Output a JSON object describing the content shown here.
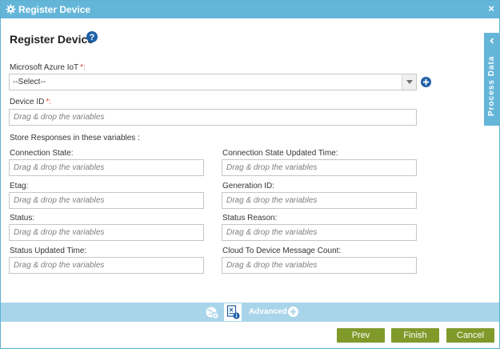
{
  "window": {
    "title": "Register Device",
    "close_label": "×"
  },
  "header": {
    "heading": "Register Device"
  },
  "azure": {
    "label": "Microsoft Azure IoT",
    "required_mark": "*:",
    "selected": "--Select--"
  },
  "device_id": {
    "label": "Device ID",
    "required_mark": "*:",
    "placeholder": "Drag & drop the variables"
  },
  "responses": {
    "section_label": "Store Responses in these variables :",
    "fields": [
      {
        "label": "Connection State:",
        "placeholder": "Drag & drop the variables"
      },
      {
        "label": "Connection State Updated Time:",
        "placeholder": "Drag & drop the variables"
      },
      {
        "label": "Etag:",
        "placeholder": "Drag & drop the variables"
      },
      {
        "label": "Generation ID:",
        "placeholder": "Drag & drop the variables"
      },
      {
        "label": "Status:",
        "placeholder": "Drag & drop the variables"
      },
      {
        "label": "Status Reason:",
        "placeholder": "Drag & drop the variables"
      },
      {
        "label": "Status Updated Time:",
        "placeholder": "Drag & drop the variables"
      },
      {
        "label": "Cloud To Device Message Count:",
        "placeholder": "Drag & drop the variables"
      }
    ]
  },
  "side_panel": {
    "label": "Process Data"
  },
  "toolbar": {
    "advanced_label": "Advanced"
  },
  "footer": {
    "prev_label": "Prev",
    "finish_label": "Finish",
    "cancel_label": "Cancel"
  },
  "colors": {
    "titlebar": "#64b6d9",
    "toolbar": "#a8d5ea",
    "button": "#7f9a2a",
    "required": "#e0433b",
    "icon_blue": "#1f5fa8"
  },
  "icons": {
    "title": "gear-icon",
    "help": "question-circle-icon",
    "add": "plus-circle-icon",
    "side_tab": "chevron-left-icon",
    "toolbar_1": "globe-gear-icon",
    "toolbar_2": "document-info-icon",
    "advanced": "plus-circle-icon"
  }
}
